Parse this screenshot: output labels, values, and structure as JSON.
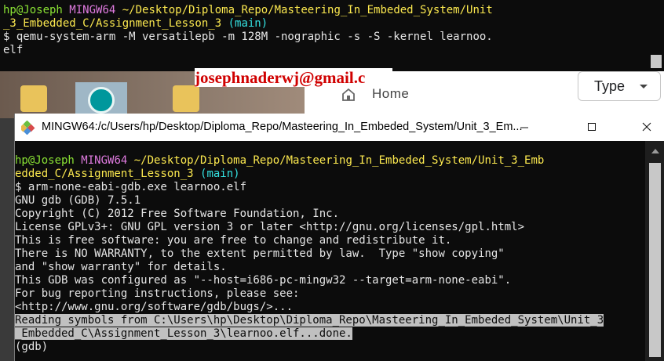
{
  "back_terminal": {
    "prompt_user": "hp@Joseph",
    "prompt_shell": "MINGW64",
    "prompt_path_1": "~/Desktop/Diploma_Repo/Masteering_In_Embeded_System/Unit",
    "prompt_path_2": "_3_Embedded_C/Assignment_Lesson_3",
    "prompt_branch": "(main)",
    "command_1": "$ qemu-system-arm -M versatilepb -m 128M -nographic -s -S -kernel learnoo.",
    "command_2": "elf"
  },
  "watermark_email": "josephnaderwj@gmail.c",
  "browser": {
    "home_label": "Home",
    "type_dropdown_label": "Type"
  },
  "front_window": {
    "title": "MINGW64:/c/Users/hp/Desktop/Diploma_Repo/Masteering_In_Embeded_System/Unit_3_Em...",
    "controls": {
      "minimize": "—",
      "maximize": "☐",
      "close": "✕"
    },
    "prompt_user": "hp@Joseph",
    "prompt_shell": "MINGW64",
    "prompt_path_1": "~/Desktop/Diploma_Repo/Masteering_In_Embeded_System/Unit_3_Emb",
    "prompt_path_2": "edded_C/Assignment_Lesson_3",
    "prompt_branch": "(main)",
    "lines": [
      "$ arm-none-eabi-gdb.exe learnoo.elf",
      "GNU gdb (GDB) 7.5.1",
      "Copyright (C) 2012 Free Software Foundation, Inc.",
      "License GPLv3+: GNU GPL version 3 or later <http://gnu.org/licenses/gpl.html>",
      "This is free software: you are free to change and redistribute it.",
      "There is NO WARRANTY, to the extent permitted by law.  Type \"show copying\"",
      "and \"show warranty\" for details.",
      "This GDB was configured as \"--host=i686-pc-mingw32 --target=arm-none-eabi\".",
      "For bug reporting instructions, please see:",
      "<http://www.gnu.org/software/gdb/bugs/>..."
    ],
    "selected_lines": [
      "Reading symbols from C:\\Users\\hp\\Desktop\\Diploma_Repo\\Masteering_In_Embeded_System\\Unit_3",
      "_Embedded_C\\Assignment_Lesson_3\\learnoo.elf...done."
    ],
    "gdb_prompt": "(gdb)"
  },
  "colors": {
    "prompt_user": "#8ae234",
    "prompt_shell": "#e07be0",
    "prompt_path": "#fce94f",
    "prompt_branch": "#34e2e2",
    "terminal_bg": "#0c0c0c",
    "email": "#d00000"
  }
}
